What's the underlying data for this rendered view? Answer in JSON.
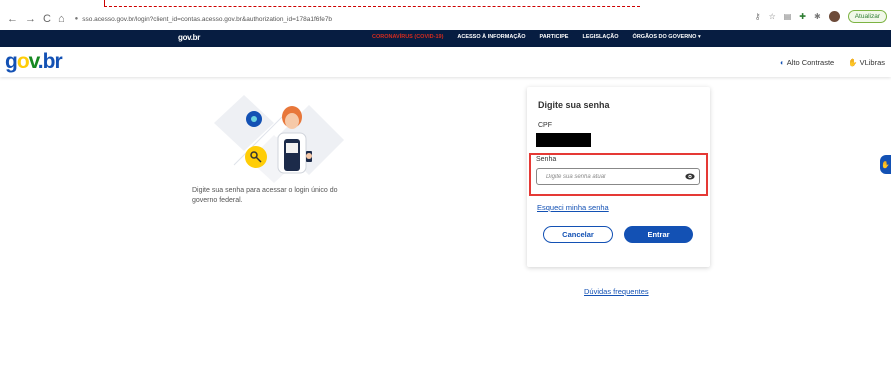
{
  "browser": {
    "nav_back": "←",
    "nav_forward": "→",
    "nav_reload": "C",
    "nav_home": "⌂",
    "lock": "🔒",
    "url": "sso.acesso.gov.br/login?client_id=contas.acesso.gov.br&authorization_id=178a1f6fe7b",
    "update_label": "Atualizar"
  },
  "gov_bar": {
    "logo": "gov.br",
    "links": [
      {
        "label": "CORONAVÍRUS (COVID-19)"
      },
      {
        "label": "ACESSO À INFORMAÇÃO"
      },
      {
        "label": "PARTICIPE"
      },
      {
        "label": "LEGISLAÇÃO"
      },
      {
        "label": "ÓRGÃOS DO GOVERNO ▾"
      }
    ]
  },
  "header": {
    "logo_g": "g",
    "logo_o": "o",
    "logo_v": "v",
    "logo_br": ".br",
    "contrast_label": "Alto Contraste",
    "vlibras_label": "VLibras"
  },
  "illustration": {
    "text": "Digite sua senha para acessar o login único do governo federal."
  },
  "card": {
    "title": "Digite sua senha",
    "cpf_label": "CPF",
    "senha_label": "Senha",
    "senha_placeholder": "Digite sua senha atual",
    "forgot_label": "Esqueci minha senha",
    "cancel_label": "Cancelar",
    "enter_label": "Entrar"
  },
  "faq_label": "Dúvidas frequentes",
  "colors": {
    "gov_bar_bg": "#071d41",
    "primary_blue": "#1351b4",
    "covid_red": "#d52b1e",
    "highlight_red": "#e53935"
  }
}
